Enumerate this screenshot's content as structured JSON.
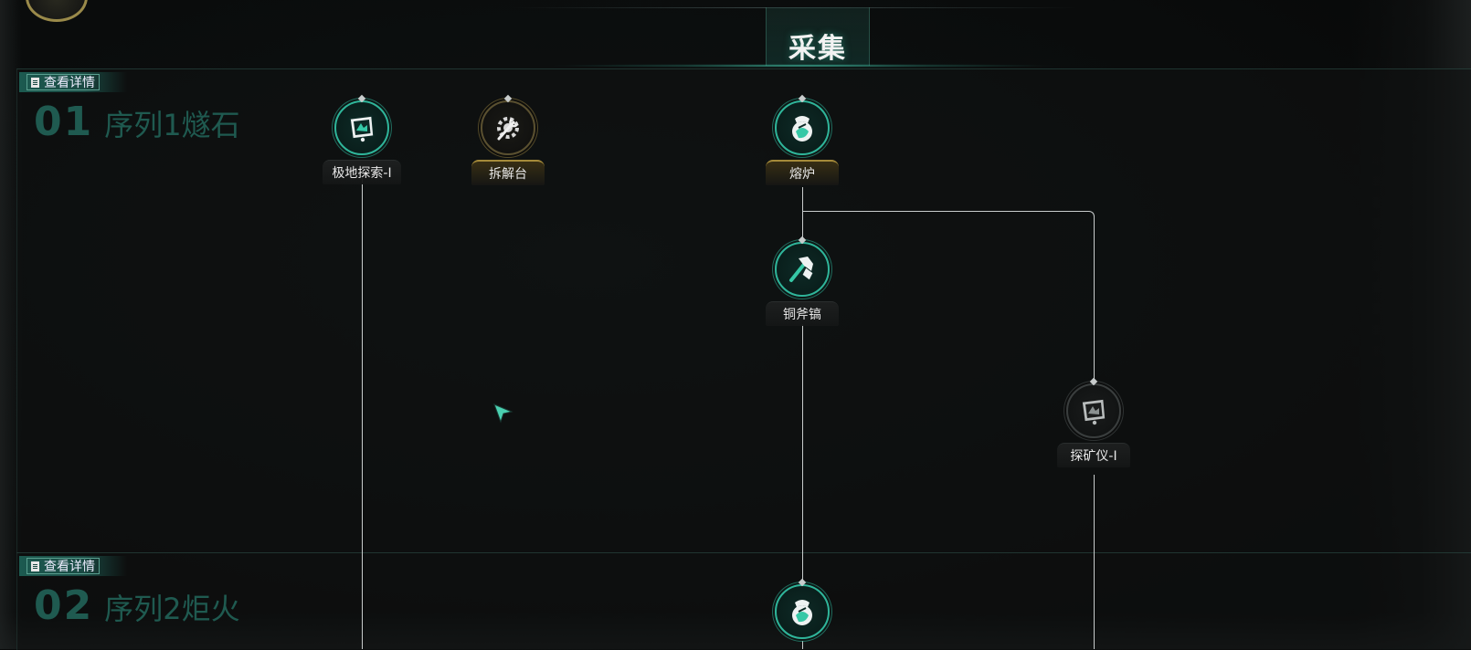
{
  "category": {
    "title": "采集"
  },
  "sections": [
    {
      "details_label": "查看详情",
      "seq_num": "01",
      "seq_name": "序列1燧石"
    },
    {
      "details_label": "查看详情",
      "seq_num": "02",
      "seq_name": "序列2炬火"
    }
  ],
  "nodes": {
    "polar_explore": {
      "label": "极地探索-I",
      "icon": "tablet-scan-icon",
      "state": "unlocked"
    },
    "disassembly": {
      "label": "拆解台",
      "icon": "gear-wrench-icon",
      "state": "locked-gold"
    },
    "furnace": {
      "label": "熔炉",
      "icon": "furnace-pot-icon",
      "state": "unlocked"
    },
    "copper_pickaxe": {
      "label": "铜斧镐",
      "icon": "pickaxe-icon",
      "state": "unlocked"
    },
    "ore_detector": {
      "label": "探矿仪-I",
      "icon": "tablet-scan-icon",
      "state": "locked"
    },
    "seq2_furnace": {
      "label": "",
      "icon": "furnace-pot-icon",
      "state": "unlocked"
    }
  },
  "colors": {
    "accent_teal": "#2fb59a",
    "gold": "#a58a3a",
    "line": "#c8cccc"
  }
}
